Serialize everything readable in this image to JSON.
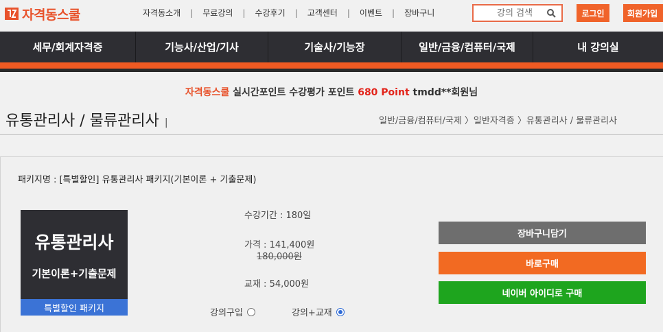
{
  "header": {
    "logo_text": "자격동스쿨",
    "nav_items": [
      "자격동소개",
      "무료강의",
      "수강후기",
      "고객센터",
      "이벤트",
      "장바구니"
    ],
    "search_placeholder": "강의 검색",
    "login_label": "로그인",
    "join_label": "회원가입"
  },
  "main_nav": [
    "세무/회계자격증",
    "기능사/산업/기사",
    "기술사/기능장",
    "일반/금융/컴퓨터/국제",
    "내 강의실"
  ],
  "notice": {
    "brand": "자격동스쿨",
    "text1": "실시간포인트 수강평가 포인트",
    "points": "680 Point",
    "text2": "tmdd**회원님"
  },
  "page": {
    "title": "유통관리사 / 물류관리사",
    "breadcrumb": "일반/금융/컴퓨터/국제 〉일반자격증 〉유통관리사 / 물류관리사"
  },
  "package": {
    "name_label": "패키지명 : [특별할인] 유통관리사 패키지(기본이론 + 기출문제)",
    "image_title": "유통관리사",
    "image_subtitle": "기본이론+기출문제",
    "image_badge": "특별할인 패키지",
    "period": "수강기간 : 180일",
    "price": "가격 : 141,400원",
    "original_price": "180,000원",
    "textbook": "교재 : 54,000원",
    "options": [
      {
        "label": "강의구입",
        "selected": false
      },
      {
        "label": "강의+교재",
        "selected": true
      }
    ]
  },
  "actions": {
    "cart": "장바구니담기",
    "buy": "바로구매",
    "naver": "네이버 아이디로 구매"
  },
  "colors": {
    "accent": "#f05a22",
    "nav_bg": "#2e2e33",
    "naver_green": "#1ea51e",
    "cart_gray": "#6e6e6e"
  }
}
